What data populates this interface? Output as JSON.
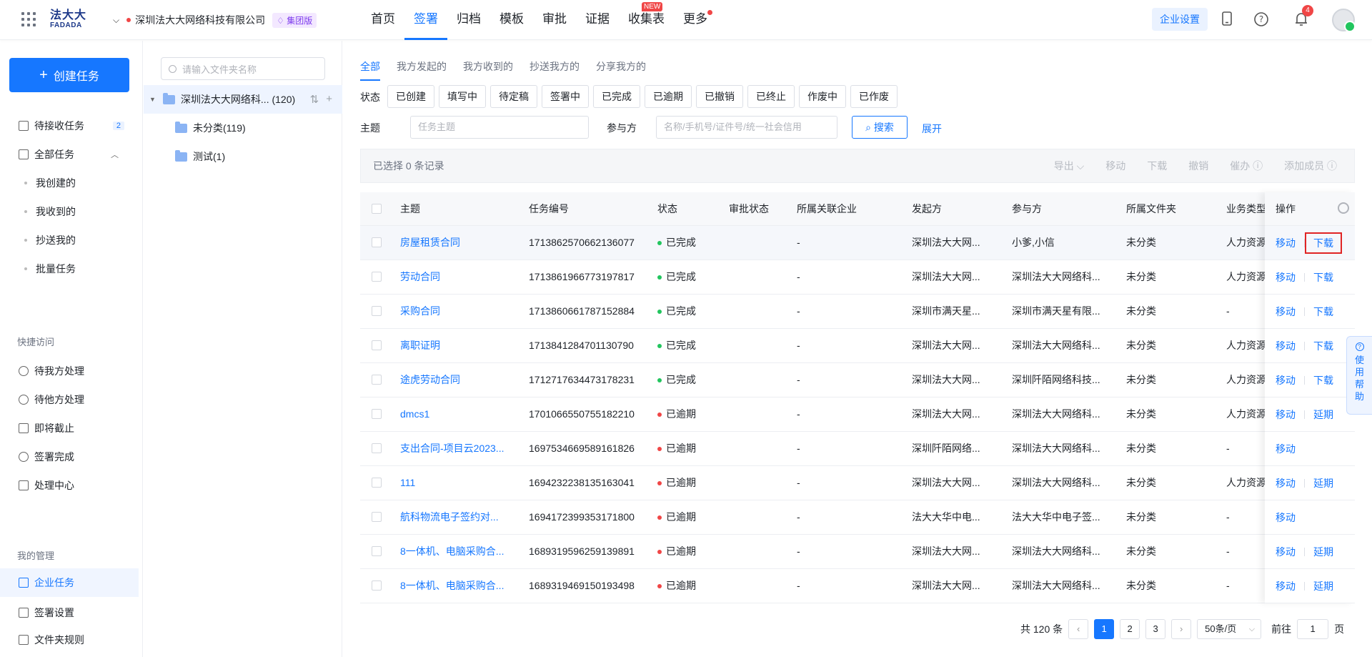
{
  "header": {
    "logo_line1": "法大大",
    "logo_line2": "FADADA",
    "org_name": "深圳法大大网络科技有限公司",
    "edition_badge": "集团版",
    "nav": [
      {
        "label": "首页"
      },
      {
        "label": "签署"
      },
      {
        "label": "归档"
      },
      {
        "label": "模板"
      },
      {
        "label": "审批"
      },
      {
        "label": "证据"
      },
      {
        "label": "收集表",
        "badge": "NEW"
      },
      {
        "label": "更多"
      }
    ],
    "enterprise_settings": "企业设置",
    "notification_count": "4"
  },
  "sidebar": {
    "create_button": "创建任务",
    "items": [
      {
        "label": "待接收任务",
        "count": "2"
      },
      {
        "label": "全部任务"
      },
      {
        "label": "我创建的"
      },
      {
        "label": "我收到的"
      },
      {
        "label": "抄送我的"
      },
      {
        "label": "批量任务"
      }
    ],
    "quick_access_title": "快捷访问",
    "quick_items": [
      {
        "label": "待我方处理"
      },
      {
        "label": "待他方处理"
      },
      {
        "label": "即将截止"
      },
      {
        "label": "签署完成"
      },
      {
        "label": "处理中心"
      }
    ],
    "my_management_title": "我的管理",
    "management_items": [
      {
        "label": "企业任务"
      },
      {
        "label": "签署设置"
      },
      {
        "label": "文件夹规则"
      }
    ]
  },
  "folder_tree": {
    "search_placeholder": "请输入文件夹名称",
    "root": "深圳法大大网络科... (120)",
    "children": [
      {
        "label": "未分类(119)"
      },
      {
        "label": "测试(1)"
      }
    ]
  },
  "main": {
    "tabs": [
      "全部",
      "我方发起的",
      "我方收到的",
      "抄送我方的",
      "分享我方的"
    ],
    "status_label": "状态",
    "status_chips": [
      "已创建",
      "填写中",
      "待定稿",
      "签署中",
      "已完成",
      "已逾期",
      "已撤销",
      "已终止",
      "作废中",
      "已作废"
    ],
    "subject_label": "主题",
    "subject_placeholder": "任务主题",
    "participant_label": "参与方",
    "participant_placeholder": "名称/手机号/证件号/统一社会信用",
    "search_button": "搜索",
    "expand": "展开",
    "selected_text": "已选择 0 条记录",
    "bulk_actions": [
      "导出 ⌵",
      "移动",
      "下载",
      "撤销",
      "催办 ⓘ",
      "添加成员 ⓘ"
    ],
    "columns": [
      "主题",
      "任务编号",
      "状态",
      "审批状态",
      "所属关联企业",
      "发起方",
      "参与方",
      "所属文件夹",
      "业务类型"
    ],
    "ops_header": "操作",
    "rows": [
      {
        "subject": "房屋租赁合同",
        "id": "1713862570662136077",
        "status": "已完成",
        "approval": "",
        "related": "-",
        "initiator": "深圳法大大网...",
        "participant": "小爹,小信",
        "folder": "未分类",
        "biz": "人力资源",
        "ops": [
          "移动",
          "下载"
        ]
      },
      {
        "subject": "劳动合同",
        "id": "1713861966773197817",
        "status": "已完成",
        "approval": "",
        "related": "-",
        "initiator": "深圳法大大网...",
        "participant": "深圳法大大网络科...",
        "folder": "未分类",
        "biz": "人力资源",
        "ops": [
          "移动",
          "下载"
        ]
      },
      {
        "subject": "采购合同",
        "id": "1713860661787152884",
        "status": "已完成",
        "approval": "",
        "related": "-",
        "initiator": "深圳市满天星...",
        "participant": "深圳市满天星有限...",
        "folder": "未分类",
        "biz": "-",
        "ops": [
          "移动",
          "下载"
        ]
      },
      {
        "subject": "离职证明",
        "id": "1713841284701130790",
        "status": "已完成",
        "approval": "",
        "related": "-",
        "initiator": "深圳法大大网...",
        "participant": "深圳法大大网络科...",
        "folder": "未分类",
        "biz": "人力资源",
        "ops": [
          "移动",
          "下载"
        ]
      },
      {
        "subject": "途虎劳动合同",
        "id": "1712717634473178231",
        "status": "已完成",
        "approval": "",
        "related": "-",
        "initiator": "深圳法大大网...",
        "participant": "深圳阡陌网络科技...",
        "folder": "未分类",
        "biz": "人力资源",
        "ops": [
          "移动",
          "下载"
        ]
      },
      {
        "subject": "dmcs1",
        "id": "1701066550755182210",
        "status": "已逾期",
        "approval": "",
        "related": "-",
        "initiator": "深圳法大大网...",
        "participant": "深圳法大大网络科...",
        "folder": "未分类",
        "biz": "人力资源",
        "ops": [
          "移动",
          "延期"
        ]
      },
      {
        "subject": "支出合同-项目云2023...",
        "id": "1697534669589161826",
        "status": "已逾期",
        "approval": "",
        "related": "-",
        "initiator": "深圳阡陌网络...",
        "participant": "深圳法大大网络科...",
        "folder": "未分类",
        "biz": "-",
        "ops": [
          "移动"
        ]
      },
      {
        "subject": "111",
        "id": "1694232238135163041",
        "status": "已逾期",
        "approval": "",
        "related": "-",
        "initiator": "深圳法大大网...",
        "participant": "深圳法大大网络科...",
        "folder": "未分类",
        "biz": "人力资源",
        "ops": [
          "移动",
          "延期"
        ]
      },
      {
        "subject": "航科物流电子签约对...",
        "id": "1694172399353171800",
        "status": "已逾期",
        "approval": "",
        "related": "-",
        "initiator": "法大大华中电...",
        "participant": "法大大华中电子签...",
        "folder": "未分类",
        "biz": "-",
        "ops": [
          "移动"
        ]
      },
      {
        "subject": "8一体机、电脑采购合...",
        "id": "1689319596259139891",
        "status": "已逾期",
        "approval": "",
        "related": "-",
        "initiator": "深圳法大大网...",
        "participant": "深圳法大大网络科...",
        "folder": "未分类",
        "biz": "-",
        "ops": [
          "移动",
          "延期"
        ]
      },
      {
        "subject": "8一体机、电脑采购合...",
        "id": "1689319469150193498",
        "status": "已逾期",
        "approval": "",
        "related": "-",
        "initiator": "深圳法大大网...",
        "participant": "深圳法大大网络科...",
        "folder": "未分类",
        "biz": "-",
        "ops": [
          "移动",
          "延期"
        ]
      }
    ],
    "help_float": "使用帮助",
    "pagination": {
      "total": "共 120 条",
      "pages": [
        "1",
        "2",
        "3"
      ],
      "current": "1",
      "page_size": "50条/页",
      "goto_prefix": "前往",
      "goto_value": "1",
      "goto_suffix": "页"
    }
  },
  "colors": {
    "primary": "#1677ff",
    "done": "#22c55e",
    "overdue": "#f04646",
    "highlight_box": "#e02424"
  }
}
